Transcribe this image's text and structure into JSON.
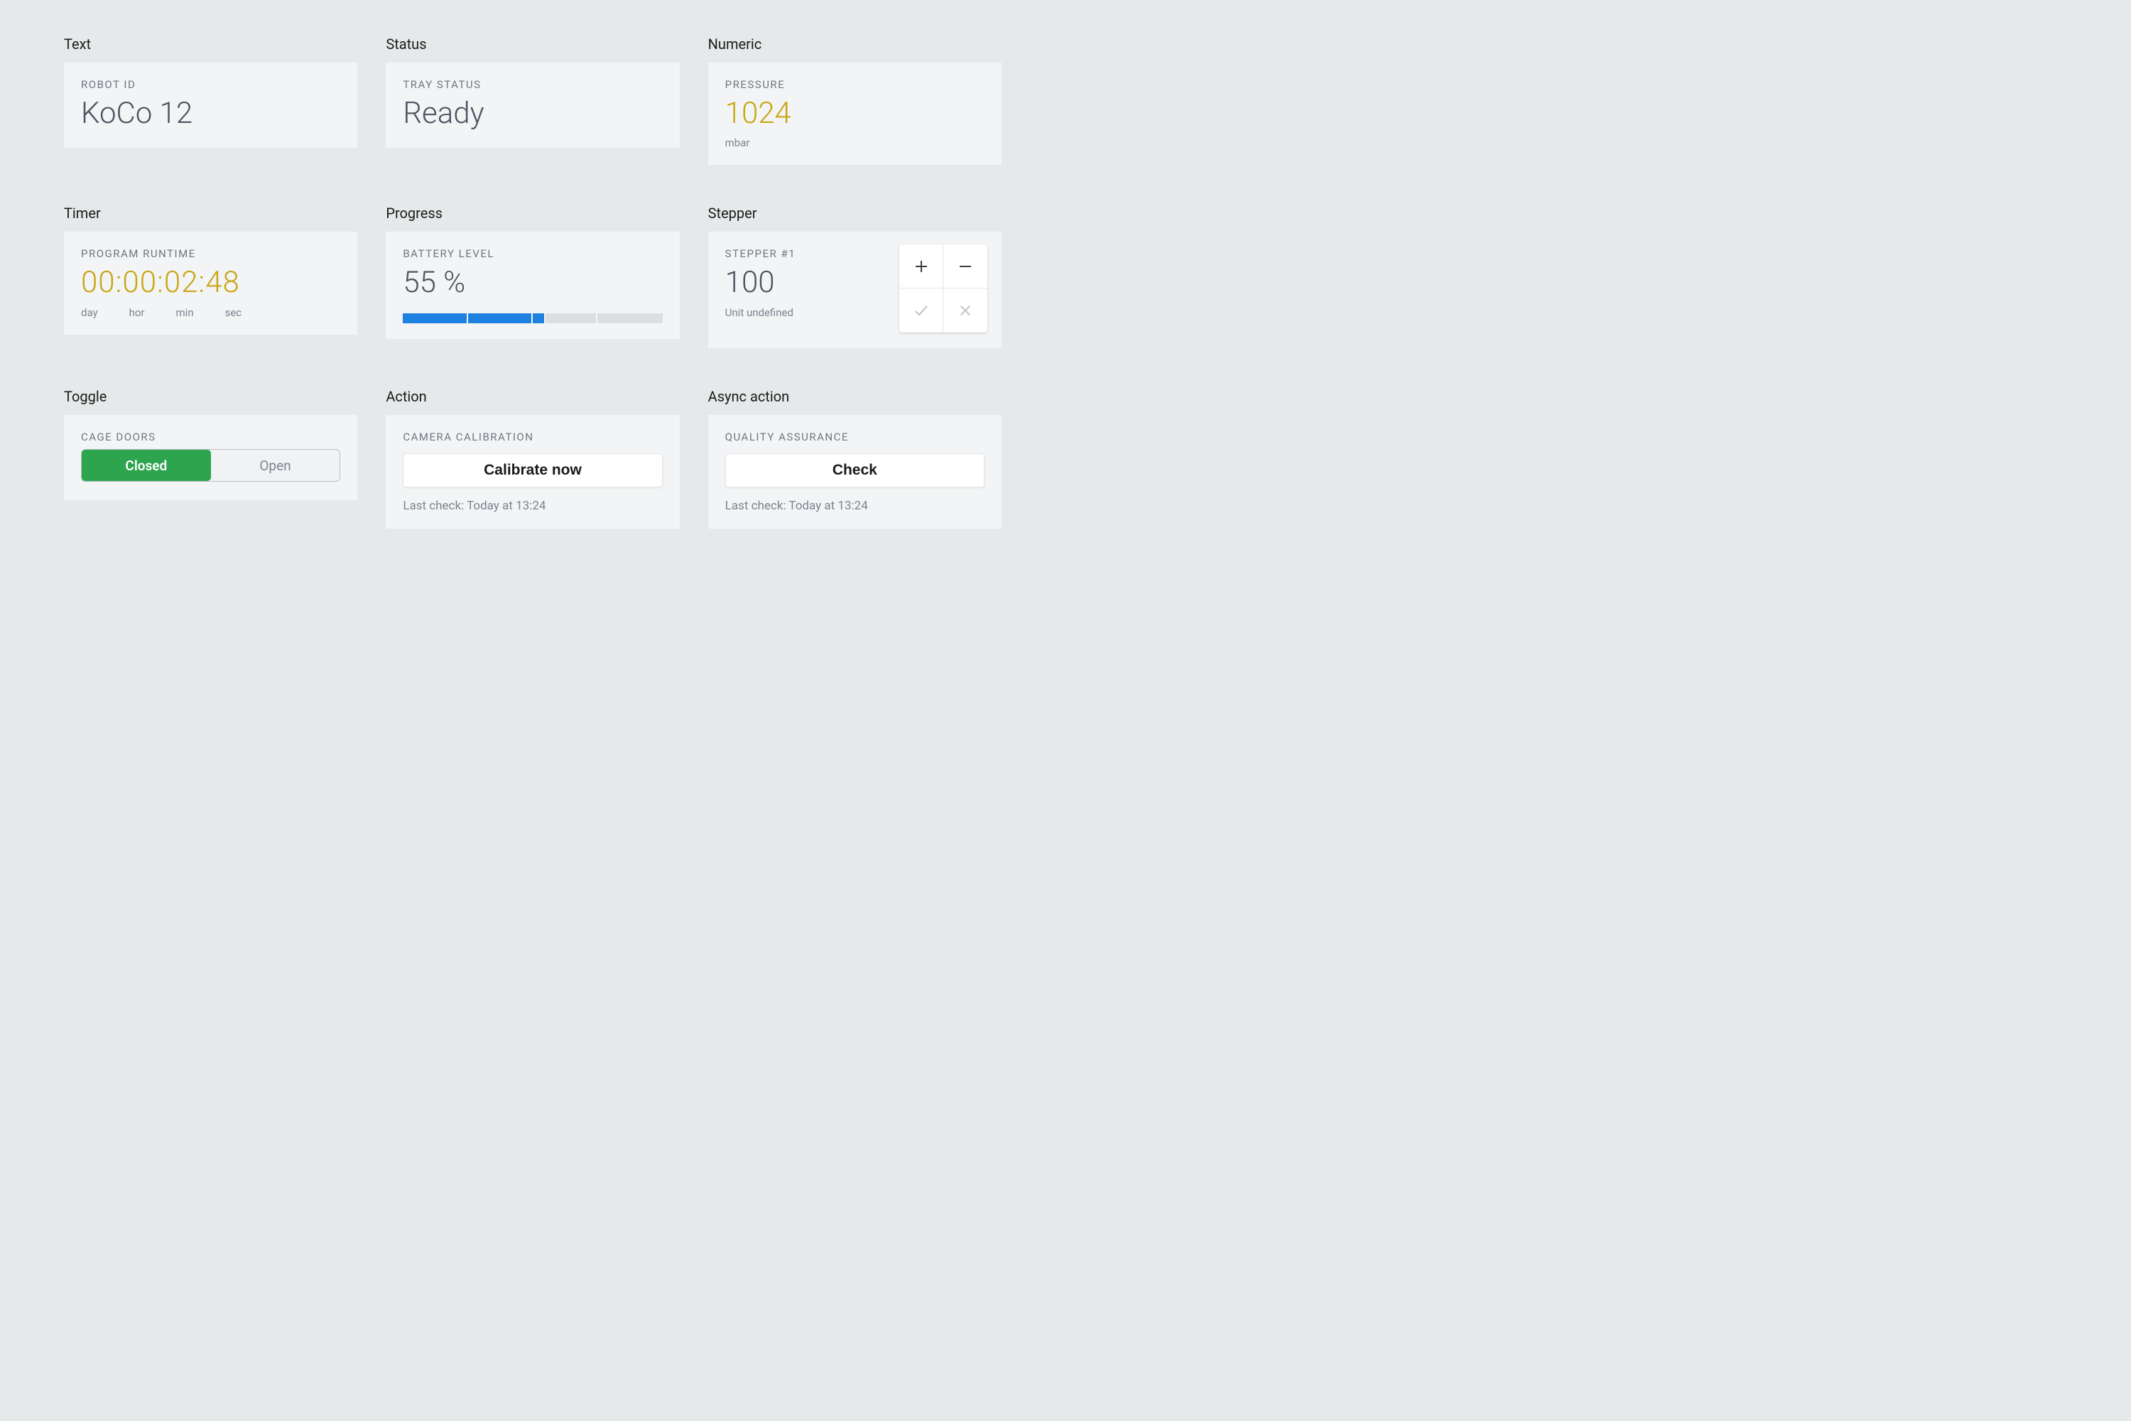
{
  "colors": {
    "accent_gold": "#c9a514",
    "progress_blue": "#1e80e0",
    "toggle_green": "#2da44e"
  },
  "sections": {
    "text": {
      "heading": "Text",
      "title": "ROBOT ID",
      "value": "KoCo 12"
    },
    "status": {
      "heading": "Status",
      "title": "TRAY STATUS",
      "value": "Ready"
    },
    "numeric": {
      "heading": "Numeric",
      "title": "PRESSURE",
      "value": "1024",
      "unit": "mbar"
    },
    "timer": {
      "heading": "Timer",
      "title": "PROGRAM RUNTIME",
      "value": "00:00:02:48",
      "labels": {
        "day": "day",
        "hor": "hor",
        "min": "min",
        "sec": "sec"
      }
    },
    "progress": {
      "heading": "Progress",
      "title": "BATTERY LEVEL",
      "value": "55 %",
      "percent": 55
    },
    "stepper": {
      "heading": "Stepper",
      "title": "STEPPER #1",
      "value": "100",
      "unit": "Unit undefined"
    },
    "toggle": {
      "heading": "Toggle",
      "title": "CAGE DOORS",
      "options": {
        "closed": "Closed",
        "open": "Open"
      },
      "selected": "closed"
    },
    "action": {
      "heading": "Action",
      "title": "CAMERA CALIBRATION",
      "button": "Calibrate now",
      "sub": "Last check: Today at 13:24"
    },
    "async_action": {
      "heading": "Async action",
      "title": "QUALITY ASSURANCE",
      "button": "Check",
      "sub": "Last check: Today at 13:24"
    }
  }
}
